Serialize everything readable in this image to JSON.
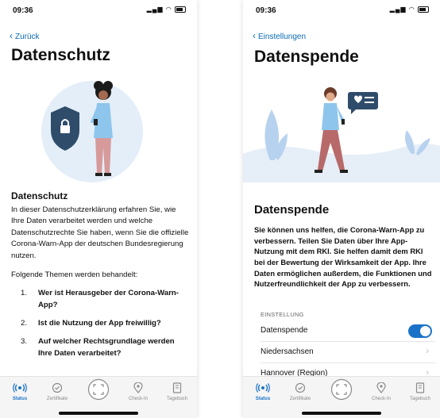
{
  "left": {
    "status_time": "09:36",
    "back_label": "Zurück",
    "page_title": "Datenschutz",
    "section_title": "Datenschutz",
    "intro_text": "In dieser Datenschutzerklärung erfahren Sie, wie Ihre Daten verarbeitet werden und welche Datenschutzrechte Sie haben, wenn Sie die offizielle Corona-Warn-App der deutschen Bundesregierung nutzen.",
    "topics_heading": "Folgende Themen werden behandelt:",
    "topics": [
      {
        "num": "1.",
        "text": "Wer ist Herausgeber der Corona-Warn-App?"
      },
      {
        "num": "2.",
        "text": "Ist die Nutzung der App freiwillig?"
      },
      {
        "num": "3.",
        "text": "Auf welcher Rechtsgrundlage werden Ihre Daten verarbeitet?"
      }
    ]
  },
  "right": {
    "status_time": "09:36",
    "back_label": "Einstellungen",
    "page_title": "Datenspende",
    "section_title": "Datenspende",
    "intro_text": "Sie können uns helfen, die Corona-Warn-App zu verbessern. Teilen Sie Daten über Ihre App-Nutzung mit dem RKI. Sie helfen damit dem RKI bei der Bewertung der Wirksamkeit der App. Ihre Daten ermöglichen außerdem, die Funktionen und Nutzerfreundlichkeit der App zu verbessern.",
    "settings_caption": "EINSTELLUNG",
    "rows": {
      "donation": "Datenspende",
      "state": "Niedersachsen",
      "region": "Hannover (Region)"
    },
    "donation_enabled": true
  },
  "tabs": [
    {
      "label": "Status",
      "icon": "status-waves-icon",
      "active": true
    },
    {
      "label": "Zertifikate",
      "icon": "certificate-icon",
      "active": false
    },
    {
      "label": "",
      "icon": "scan-qr-icon",
      "active": false
    },
    {
      "label": "Check-In",
      "icon": "location-pin-icon",
      "active": false
    },
    {
      "label": "Tagebuch",
      "icon": "diary-book-icon",
      "active": false
    }
  ],
  "colors": {
    "accent": "#1a73c8",
    "link": "#0a6bb8",
    "illustration_bg": "#e3eef9",
    "shield": "#2f4c6b"
  }
}
